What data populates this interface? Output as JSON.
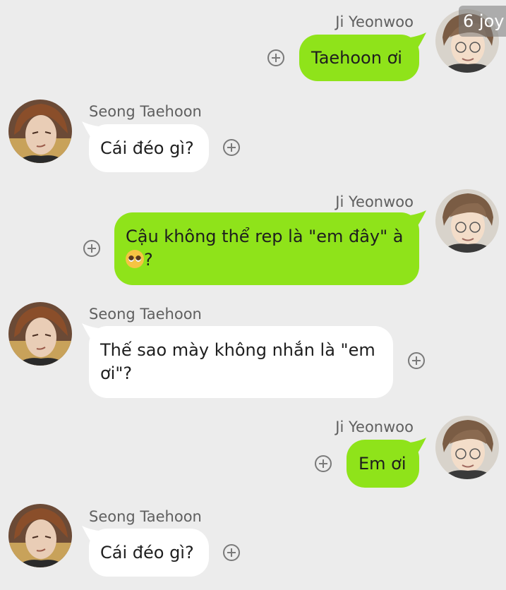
{
  "corner_badge": "6 joy",
  "messages": [
    {
      "sender": "Ji Yeonwoo",
      "direction": "out",
      "text": "Taehoon ơi"
    },
    {
      "sender": "Seong Taehoon",
      "direction": "in",
      "text": "Cái đéo gì?"
    },
    {
      "sender": "Ji Yeonwoo",
      "direction": "out",
      "text_line1": "Cậu không thể rep là \"em đây\" à",
      "text_line2": "?",
      "emoji": "pleading-face"
    },
    {
      "sender": "Seong Taehoon",
      "direction": "in",
      "text": "Thế sao mày không nhắn là \"em ơi\"?"
    },
    {
      "sender": "Ji Yeonwoo",
      "direction": "out",
      "text": "Em ơi"
    },
    {
      "sender": "Seong Taehoon",
      "direction": "in",
      "text": "Cái đéo gì?"
    }
  ],
  "colors": {
    "background": "#ececec",
    "outgoing_bubble": "#8fe31a",
    "incoming_bubble": "#ffffff",
    "name_text": "#5f5f5f"
  },
  "icons": {
    "add": "plus-circle-icon",
    "avatar_out": "ji-yeonwoo-avatar",
    "avatar_in": "seong-taehoon-avatar"
  }
}
